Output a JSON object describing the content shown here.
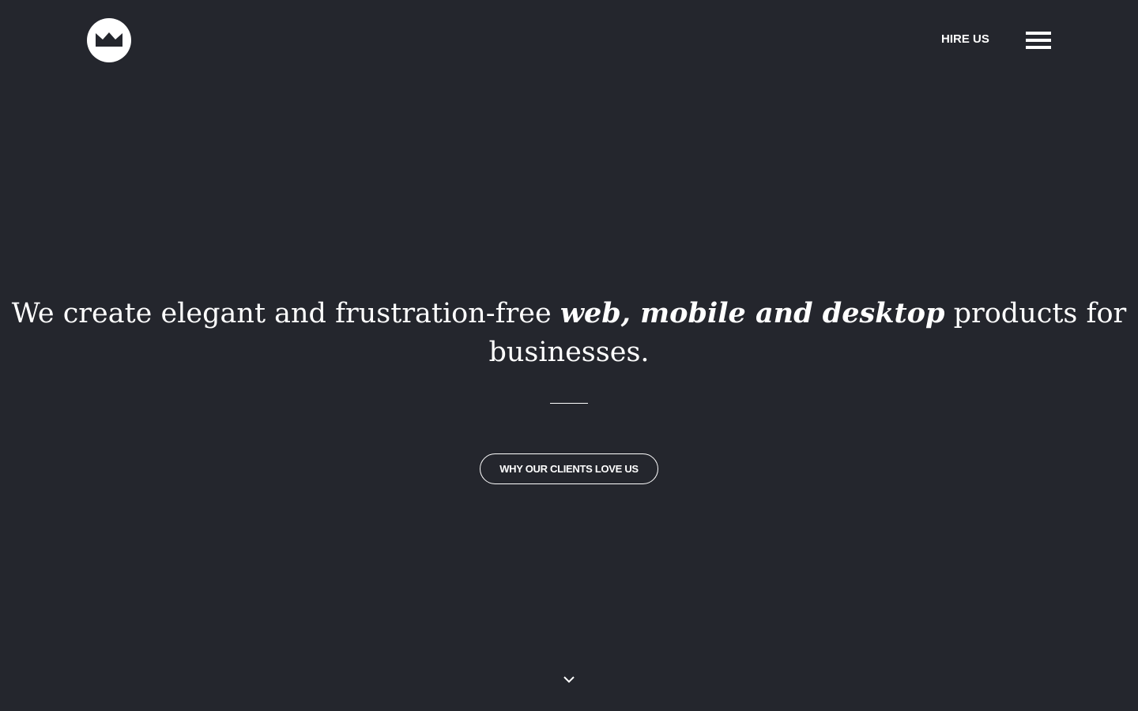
{
  "header": {
    "logo_icon": "crown-icon",
    "hire_us_label": "HIRE US",
    "menu_icon": "hamburger-menu-icon"
  },
  "hero": {
    "headline_part_1": "We create elegant and frustration-free ",
    "headline_emphasis_1": "web, mobile and desktop",
    "headline_part_2": " products for businesses.",
    "cta_label": "WHY OUR CLIENTS LOVE US"
  },
  "footer": {
    "scroll_icon": "chevron-down-icon"
  },
  "colors": {
    "background": "#24262d",
    "foreground": "#ffffff"
  }
}
